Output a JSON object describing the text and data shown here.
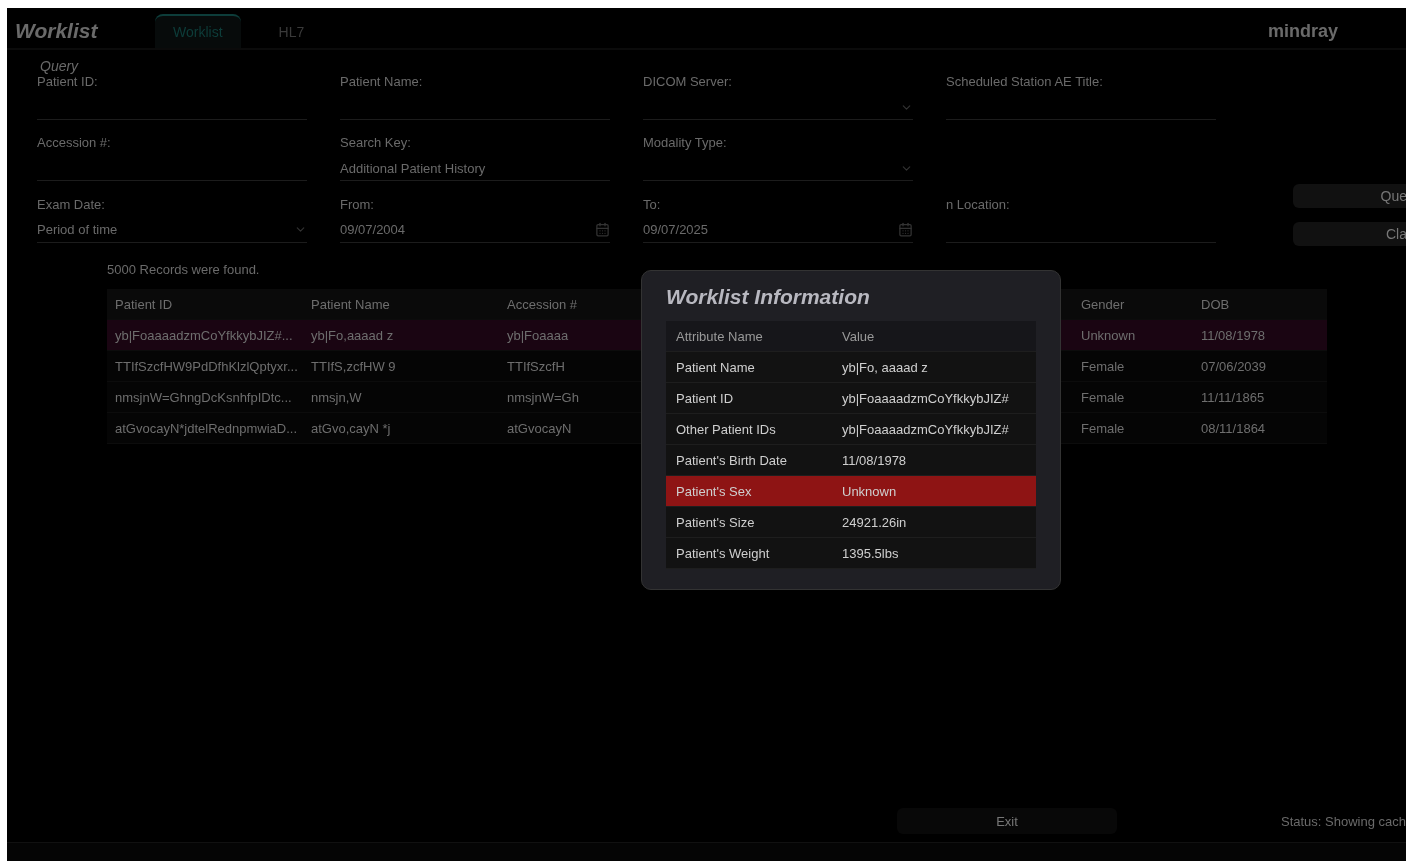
{
  "header": {
    "title": "Worklist",
    "tabs": [
      {
        "label": "Worklist",
        "selected": true
      },
      {
        "label": "HL7",
        "selected": false
      }
    ],
    "logo": "mindray"
  },
  "query": {
    "title": "Query",
    "fields": [
      {
        "kind": "text",
        "label": "Patient ID:"
      },
      {
        "kind": "text",
        "label": "Patient Name:"
      },
      {
        "kind": "dropdown",
        "label": "DICOM Server:"
      },
      {
        "kind": "text",
        "label": "Scheduled Station AE Title:"
      },
      {
        "kind": "text",
        "label": "Accession #:"
      },
      {
        "kind": "text",
        "label": "Search Key:",
        "value": "Additional Patient History"
      },
      {
        "kind": "dropdown",
        "label": "Modality Type:"
      },
      {
        "kind": "empty"
      },
      {
        "kind": "dropdown",
        "label": "Exam Date:",
        "value": "Period of time"
      },
      {
        "kind": "date",
        "label": "From:",
        "value": "09/07/2004"
      },
      {
        "kind": "date",
        "label": "To:",
        "value": "09/07/2025"
      },
      {
        "kind": "text",
        "label": "n Location:"
      }
    ],
    "buttons": [
      "Que",
      "Cla"
    ]
  },
  "results": {
    "count": "5000 Records were found.",
    "columns": [
      "Patient ID",
      "Patient Name",
      "Accession #",
      "Gender",
      "DOB"
    ],
    "rows": [
      {
        "selected": true,
        "cells": [
          "yb|FoaaaadzmCoYfkkybJIZ#...",
          "yb|Fo,aaaad z",
          "yb|Foaaaa",
          "Unknown",
          "11/08/1978"
        ]
      },
      {
        "selected": false,
        "cells": [
          "TTIfSzcfHW9PdDfhKlzlQptyxr...",
          "TTIfS,zcfHW 9",
          "TTIfSzcfH",
          "Female",
          "07/06/2039"
        ]
      },
      {
        "selected": false,
        "cells": [
          "nmsjnW=GhngDcKsnhfpIDtc...",
          "nmsjn,W",
          "nmsjnW=Gh",
          "Female",
          "11/11/1865"
        ]
      },
      {
        "selected": false,
        "cells": [
          "atGvocayN*jdtelRednpmwiaD...",
          "atGvo,cayN *j",
          "atGvocayN",
          "Female",
          "08/11/1864"
        ]
      }
    ]
  },
  "dialog": {
    "title": "Worklist Information",
    "columns": [
      "Attribute Name",
      "Value"
    ],
    "rows": [
      {
        "selected": false,
        "cells": [
          "Patient Name",
          "yb|Fo, aaaad z"
        ]
      },
      {
        "selected": false,
        "cells": [
          "Patient ID",
          "yb|FoaaaadzmCoYfkkybJIZ#"
        ]
      },
      {
        "selected": false,
        "cells": [
          "Other Patient IDs",
          "yb|FoaaaadzmCoYfkkybJIZ#"
        ]
      },
      {
        "selected": false,
        "cells": [
          "Patient's Birth Date",
          "11/08/1978"
        ]
      },
      {
        "selected": true,
        "cells": [
          "Patient's Sex",
          "Unknown"
        ]
      },
      {
        "selected": false,
        "cells": [
          "Patient's Size",
          "24921.26in"
        ]
      },
      {
        "selected": false,
        "cells": [
          "Patient's Weight",
          "1395.5lbs"
        ]
      }
    ]
  },
  "footer": {
    "exit": "Exit",
    "status": "Status: Showing cach"
  }
}
